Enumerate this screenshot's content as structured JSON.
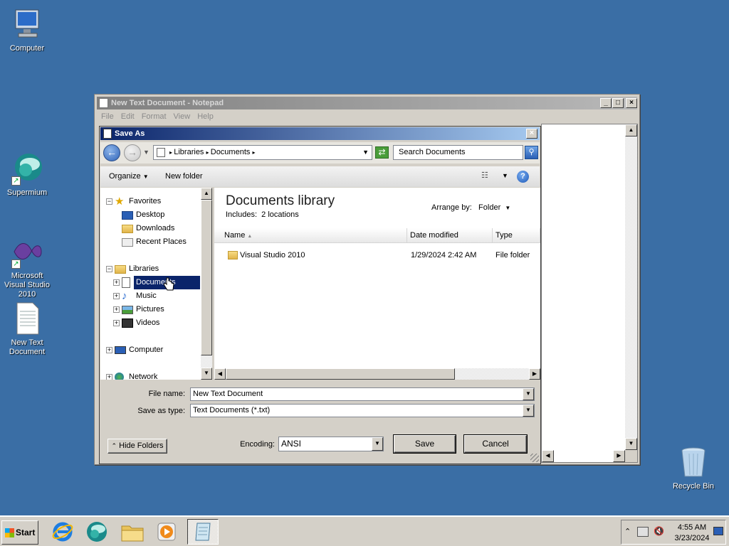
{
  "desktop": {
    "icons": [
      {
        "label": "Computer"
      },
      {
        "label": "Supermium"
      },
      {
        "label": "Microsoft Visual Studio 2010"
      },
      {
        "label": "New Text Document"
      },
      {
        "label": "Recycle Bin"
      }
    ]
  },
  "notepad": {
    "title": "New Text Document - Notepad",
    "menu": [
      "File",
      "Edit",
      "Format",
      "View",
      "Help"
    ]
  },
  "saveas": {
    "title": "Save As",
    "address": {
      "segments": [
        "Libraries",
        "Documents"
      ]
    },
    "search_placeholder": "Search Documents",
    "commands": {
      "organize": "Organize",
      "new_folder": "New folder"
    },
    "nav": {
      "favorites": "Favorites",
      "favorites_items": [
        "Desktop",
        "Downloads",
        "Recent Places"
      ],
      "libraries": "Libraries",
      "libraries_items": [
        "Documents",
        "Music",
        "Pictures",
        "Videos"
      ],
      "computer": "Computer",
      "network": "Network"
    },
    "content": {
      "library_title": "Documents library",
      "includes_label": "Includes:",
      "includes_value": "2 locations",
      "arrange_label": "Arrange by:",
      "arrange_value": "Folder",
      "columns": [
        "Name",
        "Date modified",
        "Type"
      ],
      "rows": [
        {
          "name": "Visual Studio 2010",
          "date": "1/29/2024 2:42 AM",
          "type": "File folder"
        }
      ]
    },
    "file_name_label": "File name:",
    "file_name_value": "New Text Document",
    "save_type_label": "Save as type:",
    "save_type_value": "Text Documents (*.txt)",
    "hide_folders": "Hide Folders",
    "encoding_label": "Encoding:",
    "encoding_value": "ANSI",
    "save_button": "Save",
    "cancel_button": "Cancel"
  },
  "taskbar": {
    "start": "Start",
    "clock_time": "4:55 AM",
    "clock_date": "3/23/2024"
  }
}
